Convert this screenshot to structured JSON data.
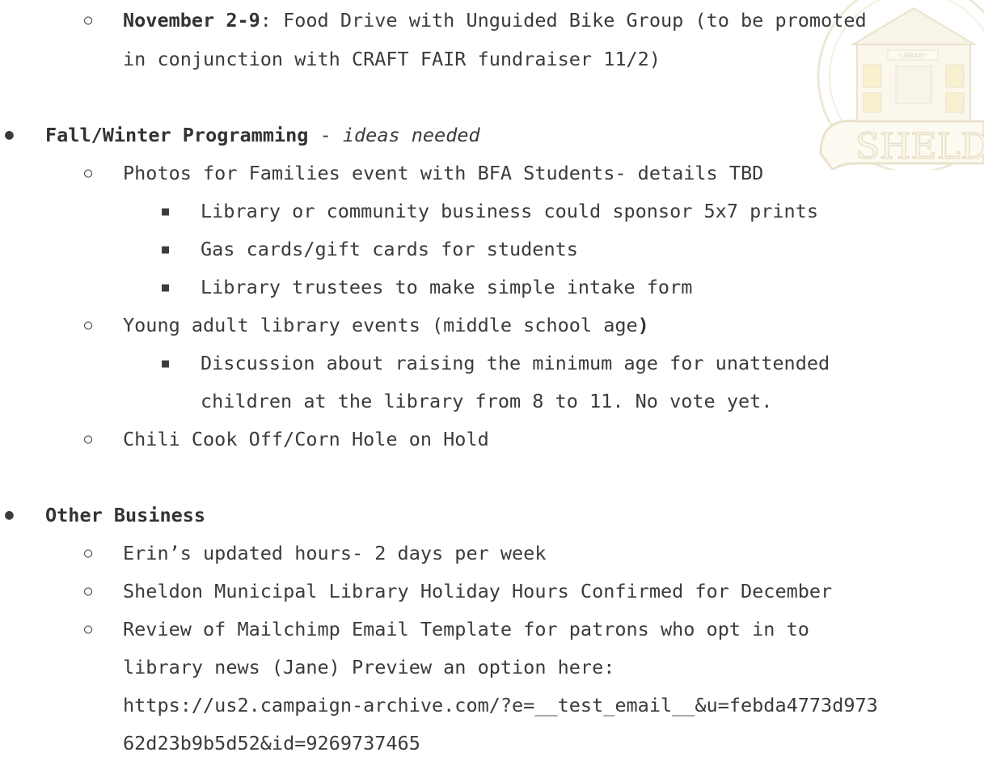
{
  "markers": {
    "disc": "●",
    "circle": "○",
    "square": "■"
  },
  "item_nov": {
    "date": "November 2-9",
    "colon": ":",
    "text_line1": " Food Drive with Unguided Bike Group (to be promoted",
    "text_line2": "in conjunction with CRAFT FAIR fundraiser 11/2)"
  },
  "watermark": {
    "building_sign": "LIBRARY",
    "banner_text": "SHELDON",
    "colors": {
      "stroke": "#e2d6b8",
      "fill": "#f4ecd4",
      "window": "#f1e7a8"
    }
  },
  "fall": {
    "title": "Fall/Winter Programming",
    "dash": " - ",
    "note": "ideas needed",
    "photos": {
      "text": "Photos for Families event with BFA Students- details TBD",
      "subs": [
        "Library or community business could sponsor 5x7 prints",
        "Gas cards/gift cards for students",
        "Library trustees to make simple intake form"
      ]
    },
    "young": {
      "text": "Young adult library events (middle school age",
      "paren": ")",
      "sub_line1": "Discussion about raising the minimum age for unattended",
      "sub_line2": "children at the library from 8 to 11. No vote yet."
    },
    "chili": "Chili Cook Off/Corn Hole on Hold"
  },
  "other": {
    "title": "Other Business",
    "items": [
      "Erin’s updated hours- 2 days per week",
      "Sheldon Municipal Library Holiday Hours Confirmed for December"
    ],
    "mailchimp": {
      "line1": "Review of Mailchimp Email Template for patrons who opt in to",
      "line2": "library news (Jane) Preview an option here:",
      "line3": "https://us2.campaign-archive.com/?e=__test_email__&u=febda4773d973",
      "line4": "62d23b9b5d52&id=9269737465"
    }
  }
}
